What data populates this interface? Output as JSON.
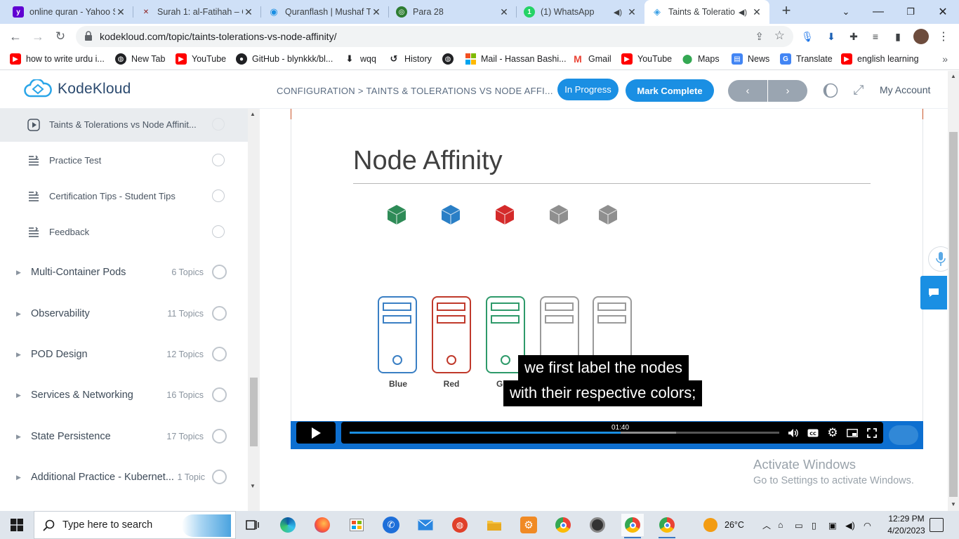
{
  "browser": {
    "tabs": [
      {
        "title": "online quran - Yahoo S",
        "favicon_color": "#6001d2",
        "favicon_glyph": "y!"
      },
      {
        "title": "Surah 1: al-Fatihah – Q",
        "favicon_color": "#8b1a1a",
        "favicon_glyph": "✕"
      },
      {
        "title": "Quranflash | Mushaf T",
        "favicon_color": "#1a8fe3",
        "favicon_glyph": "◉"
      },
      {
        "title": "Para 28",
        "favicon_color": "#2e7d32",
        "favicon_glyph": "◎"
      },
      {
        "title": "(1) WhatsApp",
        "favicon_color": "#25d366",
        "favicon_glyph": "1"
      },
      {
        "title": "Taints & Toleratio",
        "favicon_color": "#3aa0e6",
        "favicon_glyph": "◈"
      }
    ],
    "active_tab_index": 5,
    "url": "kodekloud.com/topic/taints-tolerations-vs-node-affinity/",
    "bookmarks": [
      {
        "label": "how to write urdu i...",
        "icon": "youtube-icon",
        "color": "#ff0000"
      },
      {
        "label": "New Tab",
        "icon": "globe-icon",
        "color": "#202124"
      },
      {
        "label": "YouTube",
        "icon": "youtube-icon",
        "color": "#ff0000"
      },
      {
        "label": "GitHub - blynkkk/bl...",
        "icon": "github-icon",
        "color": "#202124"
      },
      {
        "label": "wqq",
        "icon": "download-icon",
        "color": "#202124"
      },
      {
        "label": "History",
        "icon": "history-icon",
        "color": "#202124"
      },
      {
        "label": "",
        "icon": "globe-icon",
        "color": "#202124"
      },
      {
        "label": "Mail - Hassan Bashi...",
        "icon": "microsoft-icon",
        "color": "#f25022"
      },
      {
        "label": "Gmail",
        "icon": "gmail-icon",
        "color": "#ea4335"
      },
      {
        "label": "YouTube",
        "icon": "youtube-icon",
        "color": "#ff0000"
      },
      {
        "label": "Maps",
        "icon": "maps-icon",
        "color": "#34a853"
      },
      {
        "label": "News",
        "icon": "news-icon",
        "color": "#4285f4"
      },
      {
        "label": "Translate",
        "icon": "translate-icon",
        "color": "#4285f4"
      },
      {
        "label": "english learning",
        "icon": "youtube-icon",
        "color": "#ff0000"
      }
    ]
  },
  "site": {
    "brand": "KodeKloud",
    "breadcrumb": "CONFIGURATION > TAINTS & TOLERATIONS VS NODE AFFI...",
    "status_label": "In Progress",
    "complete_label": "Mark Complete",
    "prev_glyph": "‹",
    "next_glyph": "›",
    "account_label": "My Account",
    "accent_color": "#1a8fe3"
  },
  "sidebar": {
    "lessons": [
      {
        "label": "Taints & Tolerations vs Node Affinit...",
        "icon": "play-icon",
        "active": true
      },
      {
        "label": "Practice Test",
        "icon": "list-icon",
        "active": false
      },
      {
        "label": "Certification Tips - Student Tips",
        "icon": "list-icon",
        "active": false
      },
      {
        "label": "Feedback",
        "icon": "list-icon",
        "active": false
      }
    ],
    "sections": [
      {
        "label": "Multi-Container Pods",
        "count": "6 Topics"
      },
      {
        "label": "Observability",
        "count": "11 Topics"
      },
      {
        "label": "POD Design",
        "count": "12 Topics"
      },
      {
        "label": "Services & Networking",
        "count": "16 Topics"
      },
      {
        "label": "State Persistence",
        "count": "17 Topics"
      },
      {
        "label": "Additional Practice - Kubernet...",
        "count": "1 Topic"
      }
    ]
  },
  "video": {
    "slide_title": "Node Affinity",
    "cube_colors": [
      "#2e8b57",
      "#2a7fc6",
      "#d42a2a",
      "#8f8f8f",
      "#8f8f8f"
    ],
    "servers": [
      {
        "label": "Blue",
        "color": "#3a7fc4"
      },
      {
        "label": "Red",
        "color": "#c0392b"
      },
      {
        "label": "Gr",
        "color": "#2e9a6a"
      },
      {
        "label": "",
        "color": "#9a9a9a"
      },
      {
        "label": "",
        "color": "#9a9a9a"
      }
    ],
    "caption_lines": [
      "we first label the nodes",
      "with their respective colors;"
    ],
    "current_time": "01:40",
    "progress_fraction": 0.63,
    "buffered_fraction": 0.76
  },
  "overlay": {
    "activate_heading": "Activate Windows",
    "activate_sub": "Go to Settings to activate Windows."
  },
  "taskbar": {
    "search_placeholder": "Type here to search",
    "weather": "26°C",
    "time": "12:29 PM",
    "date": "4/20/2023"
  }
}
